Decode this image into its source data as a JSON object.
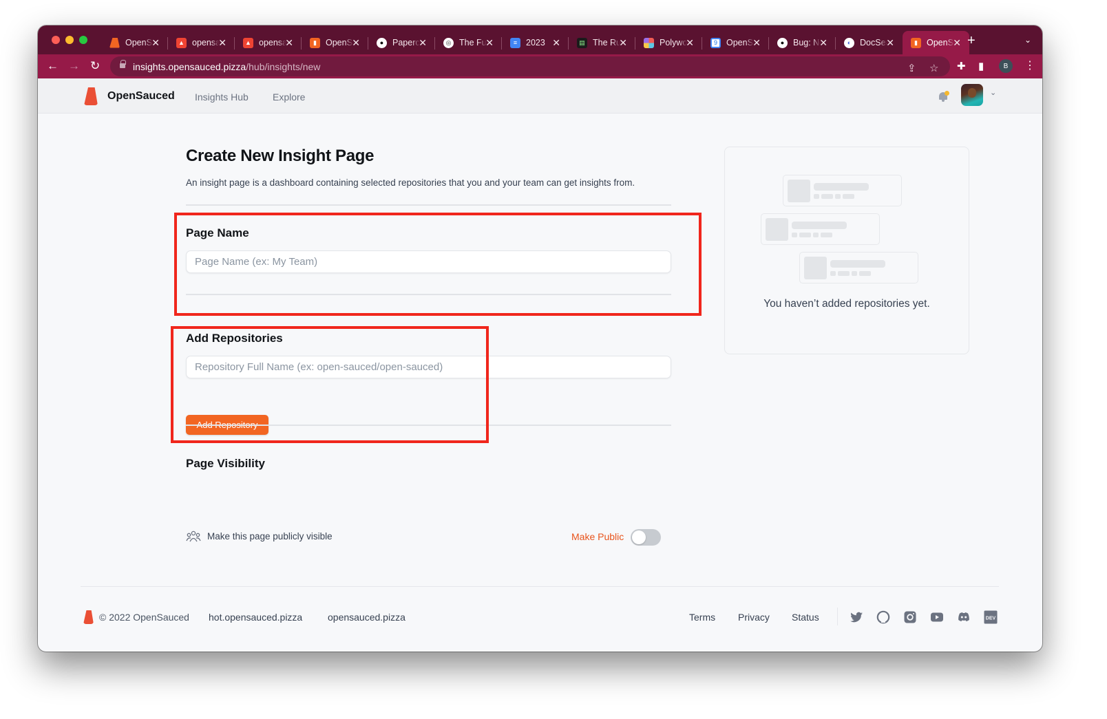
{
  "browser": {
    "tabs": [
      {
        "title": "OpenSauced",
        "favicon": "opensauced-orange",
        "active": false
      },
      {
        "title": "opensauced",
        "favicon": "red-app-icon",
        "active": false
      },
      {
        "title": "opensauced",
        "favicon": "red-app-icon",
        "active": false
      },
      {
        "title": "OpenSauced",
        "favicon": "opensauced-logo",
        "active": false
      },
      {
        "title": "Papercups",
        "favicon": "github-icon",
        "active": false
      },
      {
        "title": "The Future",
        "favicon": "spiral-icon",
        "active": false
      },
      {
        "title": "2023",
        "favicon": "google-docs-icon",
        "active": false
      },
      {
        "title": "The Rust",
        "favicon": "terminal-icon",
        "active": false
      },
      {
        "title": "Polywork",
        "favicon": "grid-icon",
        "active": false
      },
      {
        "title": "OpenSauced",
        "favicon": "calendar-icon",
        "active": false
      },
      {
        "title": "Bug: No",
        "favicon": "github-icon",
        "active": false
      },
      {
        "title": "DocSearch",
        "favicon": "docsearch-icon",
        "active": false
      },
      {
        "title": "OpenSauced",
        "favicon": "opensauced-logo",
        "active": true
      }
    ],
    "url_host": "insights.opensauced.pizza",
    "url_path": "/hub/insights/new",
    "profile_initial": "B",
    "new_tab_glyph": "+",
    "close_glyph": "✕"
  },
  "header": {
    "brand": "OpenSauced",
    "nav": [
      {
        "label": "Insights Hub"
      },
      {
        "label": "Explore"
      }
    ],
    "notification_badge": true
  },
  "main": {
    "title": "Create New Insight Page",
    "description": "An insight page is a dashboard containing selected repositories that you and your team can get insights from.",
    "page_name": {
      "label": "Page Name",
      "placeholder": "Page Name (ex: My Team)",
      "value": ""
    },
    "repositories": {
      "label": "Add Repositories",
      "placeholder": "Repository Full Name (ex: open-sauced/open-sauced)",
      "value": "",
      "button_label": "Add Repository"
    },
    "visibility": {
      "label": "Page Visibility",
      "description": "Make this page publicly visible",
      "toggle_label": "Make Public",
      "is_public": false
    },
    "empty_state": {
      "message": "You haven’t added repositories yet."
    }
  },
  "footer": {
    "copyright": "© 2022 OpenSauced",
    "links_left": [
      "hot.opensauced.pizza",
      "opensauced.pizza"
    ],
    "links_right": [
      "Terms",
      "Privacy",
      "Status"
    ],
    "social": [
      "twitter",
      "github",
      "instagram",
      "youtube",
      "discord",
      "dev"
    ],
    "dev_label": "DEV"
  },
  "colors": {
    "brand": "#ea4f35",
    "primary_button": "#f26522",
    "tab_strip": "#5a1230",
    "toolbar": "#961a48",
    "annotation": "#f0261c"
  }
}
